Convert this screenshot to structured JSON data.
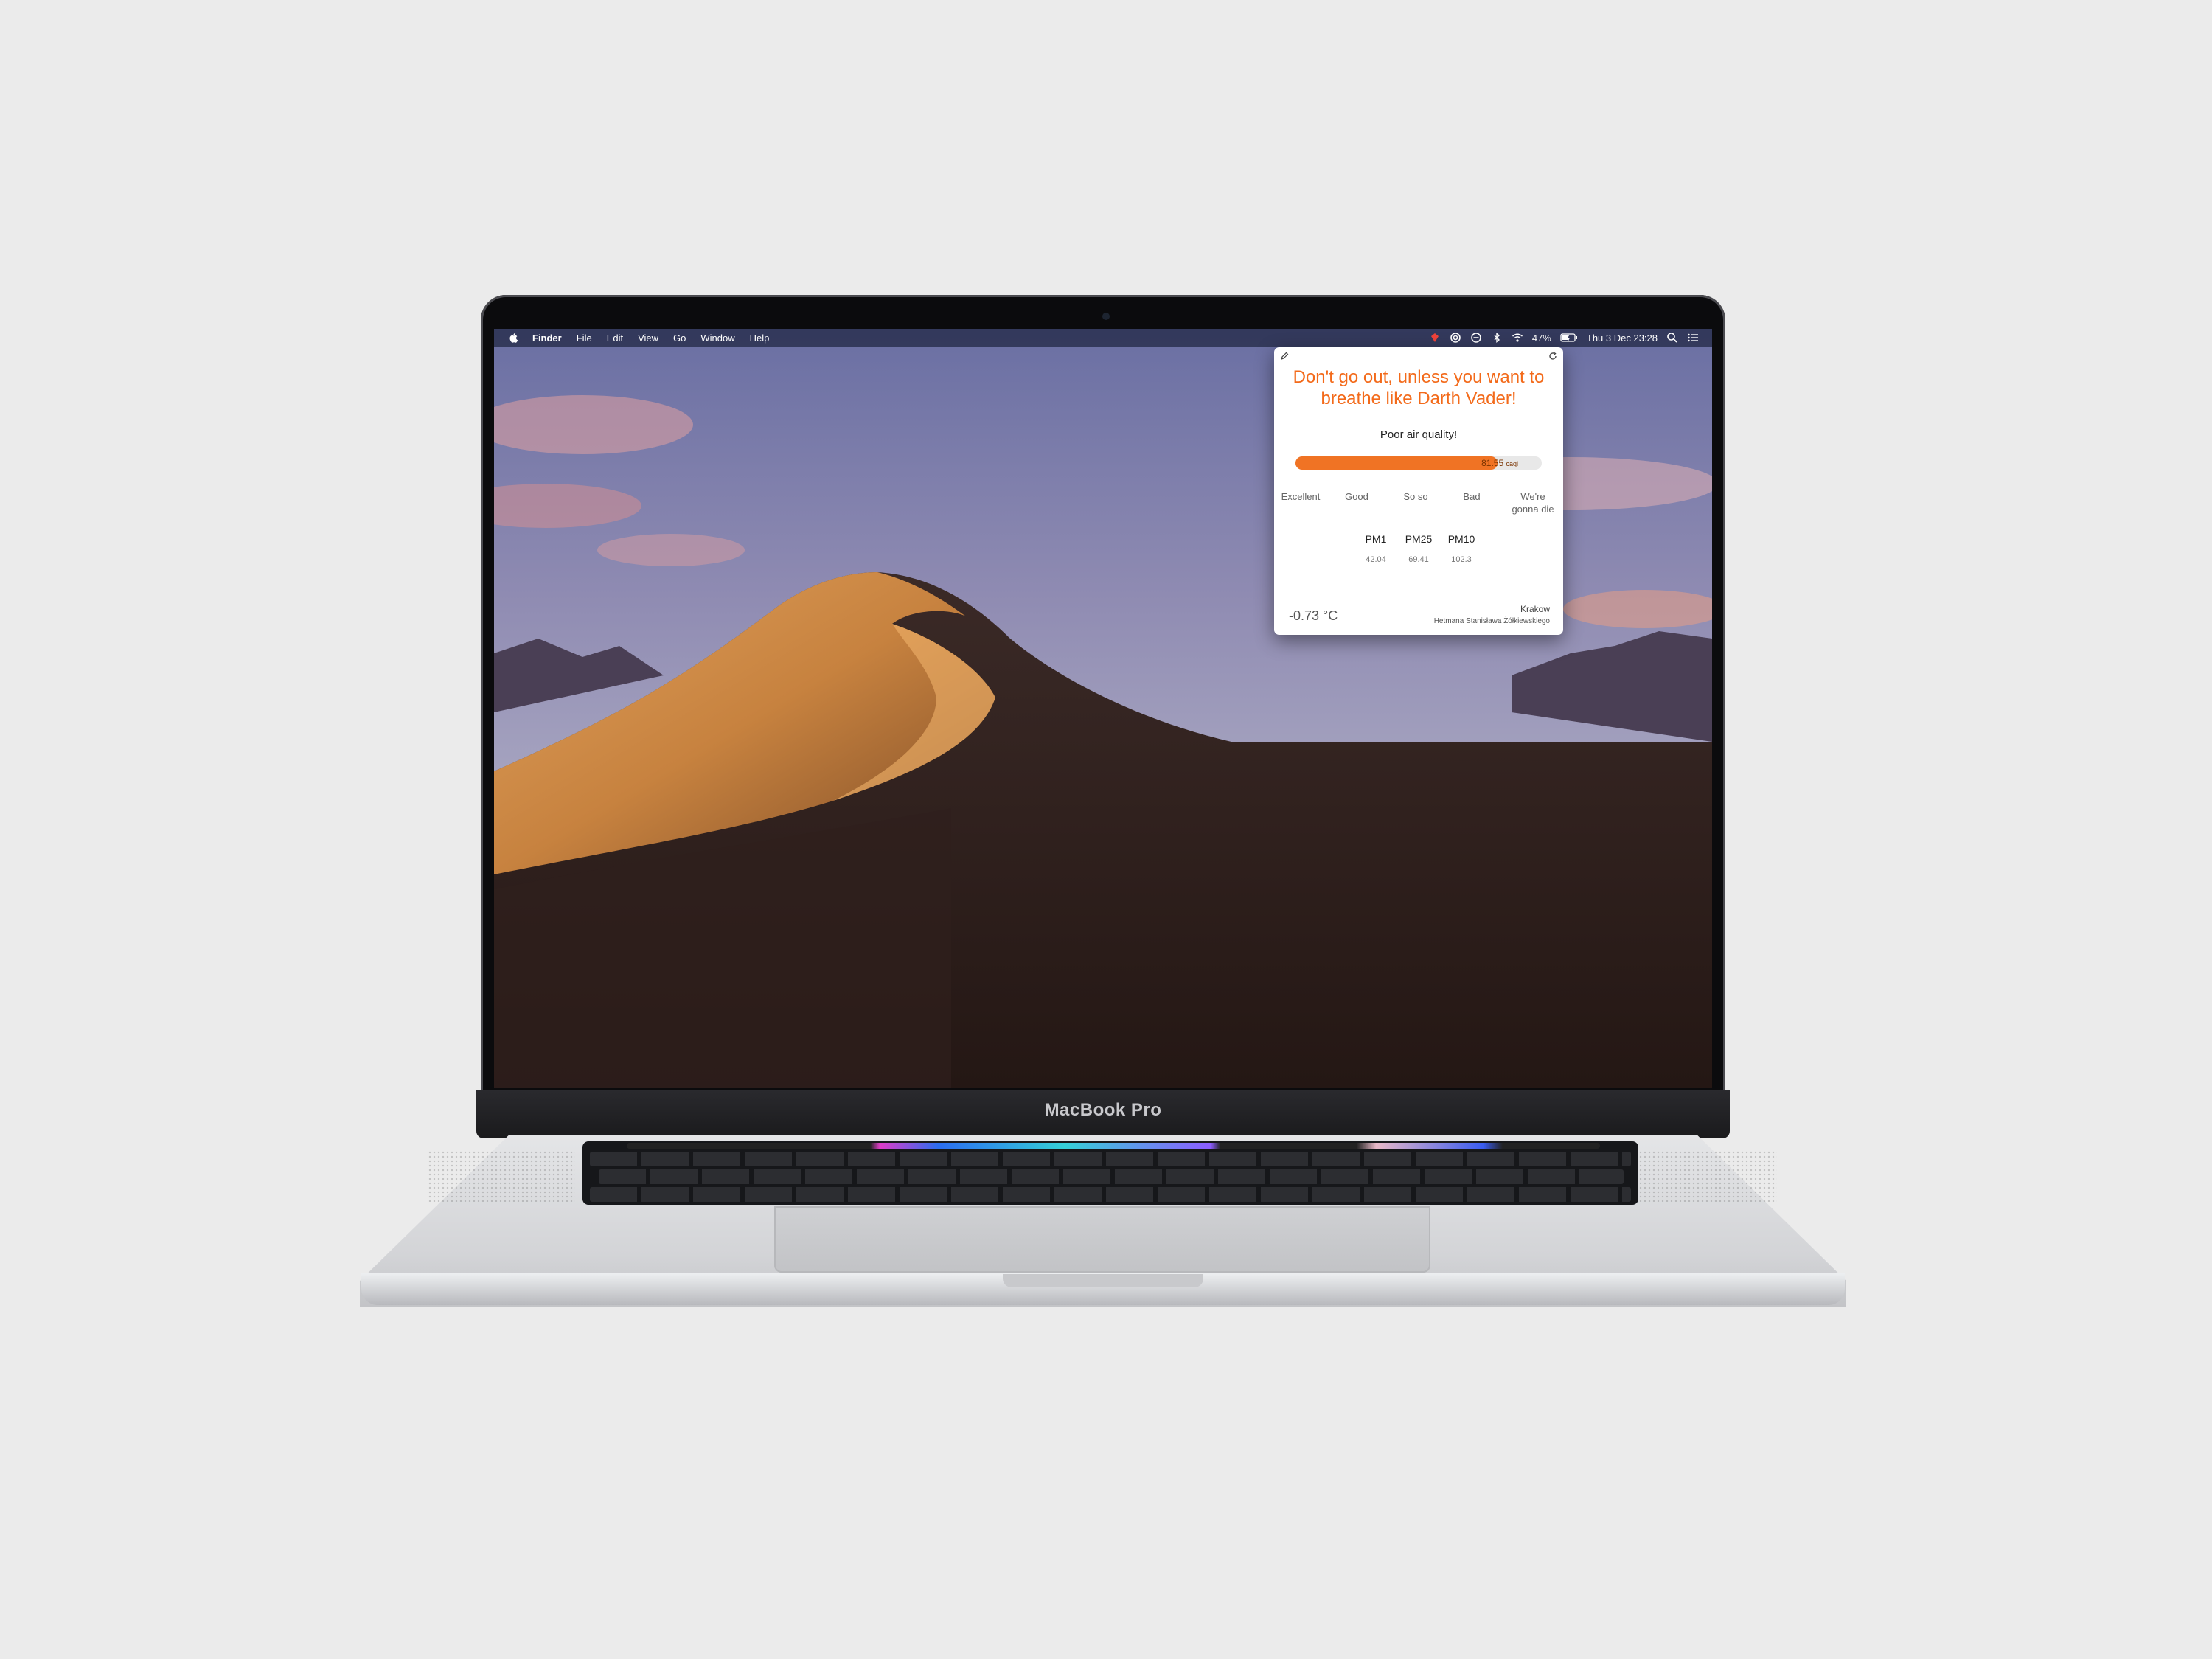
{
  "device": {
    "brand_label": "MacBook Pro"
  },
  "menubar": {
    "app_name": "Finder",
    "items": [
      "File",
      "Edit",
      "View",
      "Go",
      "Window",
      "Help"
    ],
    "battery": "47%",
    "datetime": "Thu 3 Dec  23:28"
  },
  "popover": {
    "headline": "Don't go out, unless you want to breathe like Darth Vader!",
    "quality_label": "Poor air quality!",
    "caqi_value": "81.55",
    "caqi_unit": "caqi",
    "caqi_fraction": 0.82,
    "bar_color": "#f07324",
    "headline_color": "#f36a1a",
    "scale_labels": [
      "Excellent",
      "Good",
      "So so",
      "Bad",
      "We're gonna die"
    ],
    "pm": [
      {
        "name": "PM1",
        "value": "42.04"
      },
      {
        "name": "PM25",
        "value": "69.41"
      },
      {
        "name": "PM10",
        "value": "102.3"
      }
    ],
    "temperature": "-0.73 °C",
    "city": "Krakow",
    "street": "Hetmana Stanisława Żółkiewskiego"
  }
}
